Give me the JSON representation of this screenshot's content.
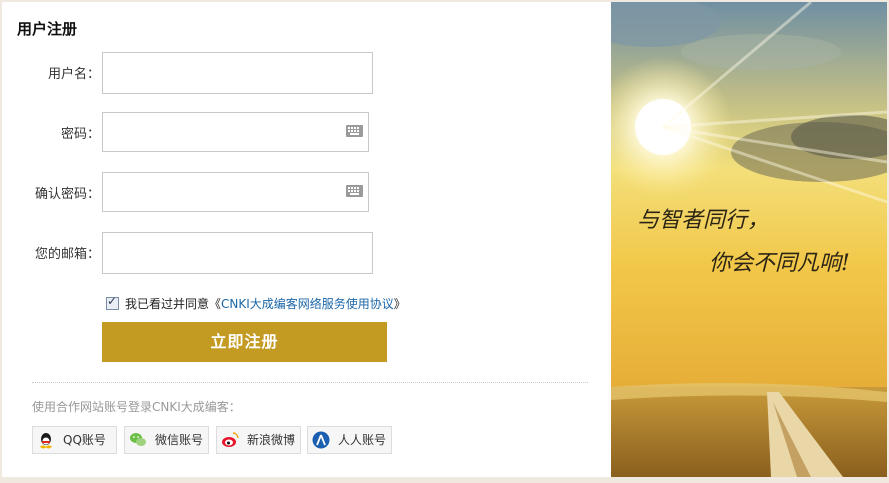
{
  "form": {
    "title": "用户注册",
    "fields": [
      {
        "label": "用户名：",
        "value": "",
        "placeholder": ""
      },
      {
        "label": "密码：",
        "value": "",
        "placeholder": ""
      },
      {
        "label": "确认密码：",
        "value": "",
        "placeholder": ""
      },
      {
        "label": "您的邮箱：",
        "value": "",
        "placeholder": ""
      }
    ],
    "agree": {
      "checked": true,
      "prefix": "我已看过并同意《",
      "link_text": "CNKI大成编客网络服务使用协议",
      "suffix": "》"
    },
    "submit_label": "立即注册"
  },
  "partners": {
    "label": "使用合作网站账号登录CNKI大成编客：",
    "items": [
      {
        "label": "QQ账号",
        "icon": "qq-icon"
      },
      {
        "label": "微信账号",
        "icon": "wechat-icon"
      },
      {
        "label": "新浪微博",
        "icon": "weibo-icon"
      },
      {
        "label": "人人账号",
        "icon": "renren-icon"
      }
    ]
  },
  "banner": {
    "line1": "与智者同行，",
    "line2": "你会不同凡响!"
  },
  "colors": {
    "accent": "#c39a22",
    "link": "#1b66a8"
  }
}
